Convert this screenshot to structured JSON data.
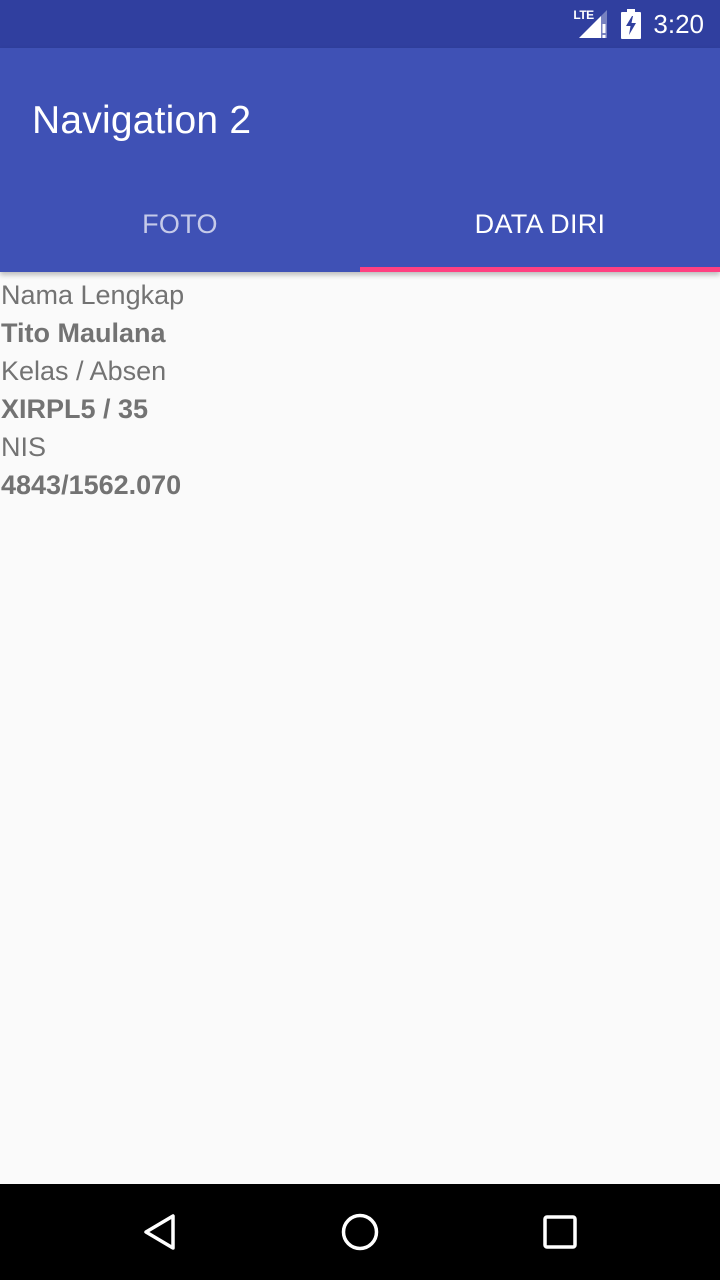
{
  "status_bar": {
    "network_label": "LTE",
    "time": "3:20",
    "icons": [
      "lte-signal-icon",
      "battery-charging-icon"
    ]
  },
  "app_bar": {
    "title": "Navigation 2",
    "background_color": "#3f51b5",
    "status_color": "#303f9f"
  },
  "tabs": [
    {
      "label": "FOTO",
      "selected": false
    },
    {
      "label": "DATA DIRI",
      "selected": true
    }
  ],
  "tab_indicator_color": "#ff4081",
  "content": {
    "rows": [
      {
        "label": "Nama Lengkap",
        "value": "Tito Maulana"
      },
      {
        "label": "Kelas / Absen",
        "value": "XIRPL5 / 35"
      },
      {
        "label": "NIS",
        "value": "4843/1562.070"
      }
    ]
  },
  "nav_bar": {
    "buttons": [
      "back-icon",
      "home-icon",
      "recents-icon"
    ]
  }
}
